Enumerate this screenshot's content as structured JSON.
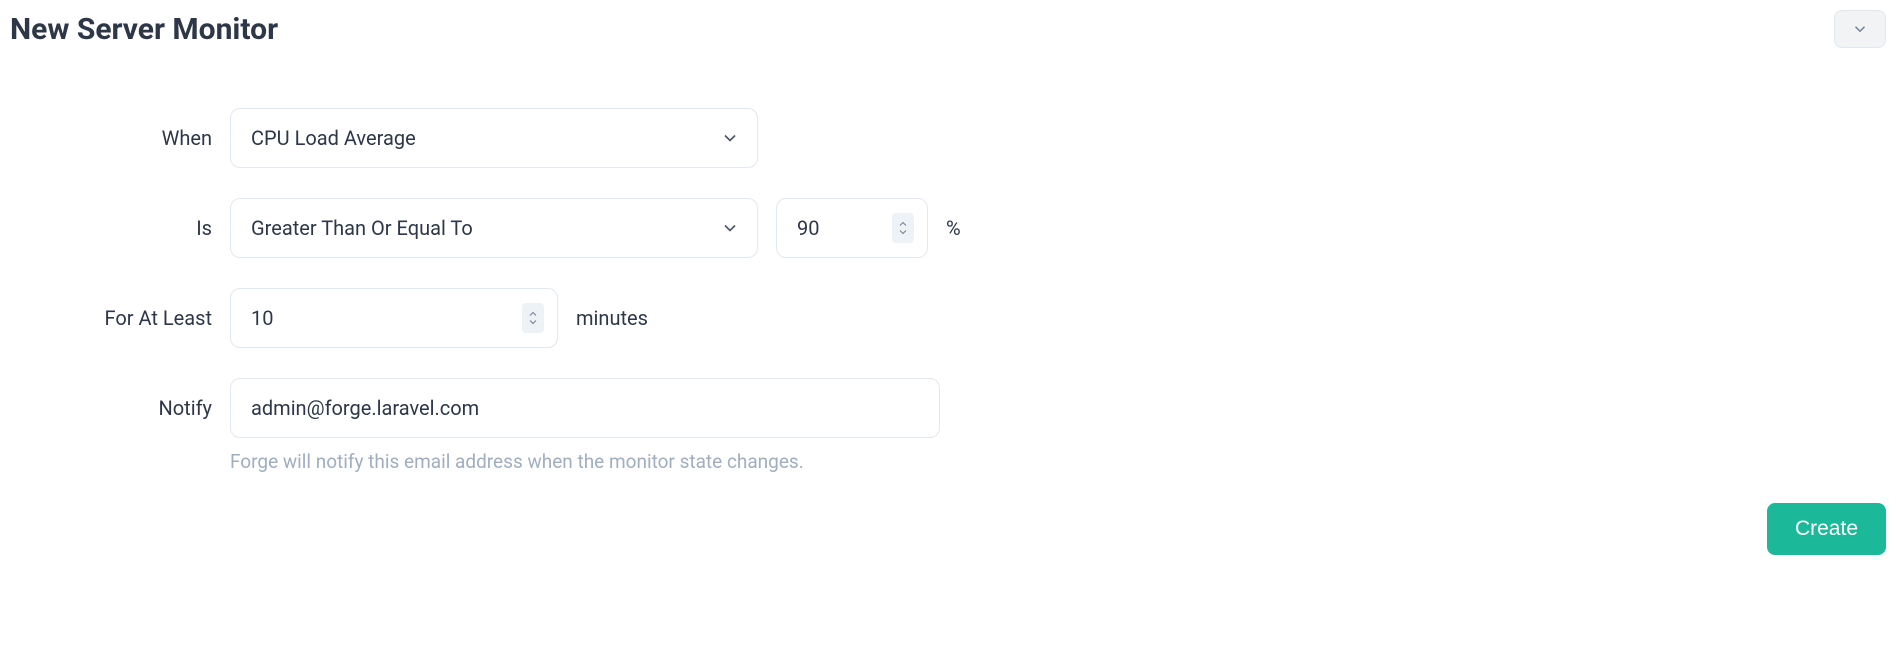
{
  "header": {
    "title": "New Server Monitor"
  },
  "form": {
    "when": {
      "label": "When",
      "select_value": "CPU Load Average"
    },
    "is": {
      "label": "Is",
      "select_value": "Greater Than Or Equal To",
      "threshold_value": "90",
      "unit": "%"
    },
    "for_at_least": {
      "label": "For At Least",
      "duration_value": "10",
      "unit": "minutes"
    },
    "notify": {
      "label": "Notify",
      "email_value": "admin@forge.laravel.com",
      "helper": "Forge will notify this email address when the monitor state changes."
    }
  },
  "footer": {
    "create_button": "Create"
  }
}
